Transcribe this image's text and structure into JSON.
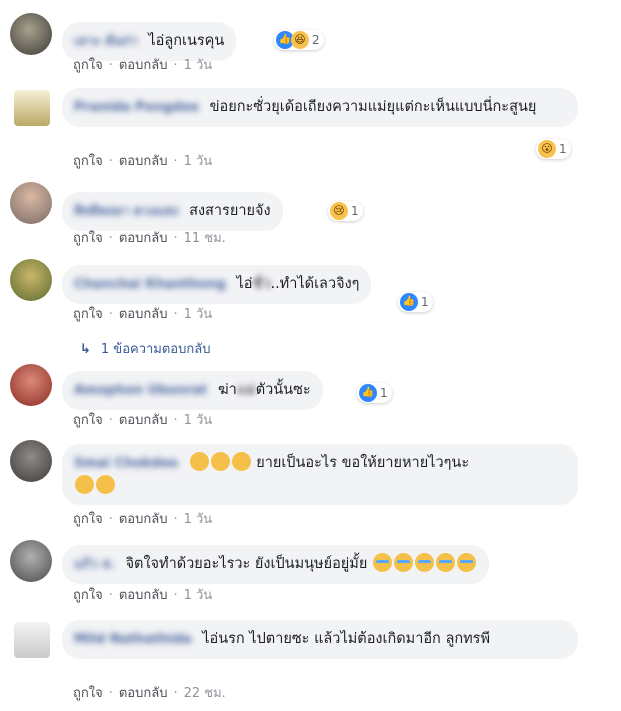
{
  "actions": {
    "like": "ถูกใจ",
    "reply": "ตอบกลับ",
    "sep": "·"
  },
  "comments": [
    {
      "author": "เลาะ ดันก่า",
      "text": "ไอ่ลูกเนรคุน",
      "time": "1 วัน",
      "reaction_count": "2",
      "reaction_icons": [
        "like-icon",
        "laugh-icon"
      ]
    },
    {
      "author": "Pranida Pongdee",
      "text": "ข่อยกะซั่วยุเด้อเถียงความแม่ยุแต่กะเห็นแบบนี่กะสูนยุ",
      "time": "1 วัน",
      "reaction_count": "1",
      "reaction_icons": [
        "wow-icon"
      ]
    },
    {
      "author": "สิทธิพงษา ดวงแสง",
      "text": "สงสารยายจัง",
      "time": "11 ชม.",
      "reaction_count": "1",
      "reaction_icons": [
        "sad-icon"
      ]
    },
    {
      "author": "Chanchai Khanthong",
      "text_before": "ไอ่",
      "text_blur": "ชั่ว",
      "text_after": "..ทำได้เลวจิงๆ",
      "time": "1 วัน",
      "reaction_count": "1",
      "reaction_icons": [
        "like-icon"
      ]
    },
    {
      "author": "Amophon Ubonrat",
      "text_before": "ฆ่า",
      "text_blur": "แม่",
      "text_after": "ตัวนั้นซะ",
      "time": "1 วัน",
      "reaction_count": "1",
      "reaction_icons": [
        "like-icon"
      ]
    },
    {
      "author": "Smai Chokdee",
      "text": "ยายเป็นอะไร ขอให้ยายหายไวๆนะ",
      "time": "1 วัน"
    },
    {
      "author": "แก้ว ส.",
      "text": "จิตใจทำด้วยอะไรวะ ยังเป็นมนุษย์อยู่มั้ย",
      "time": "1 วัน"
    },
    {
      "author": "Mild Nathathida",
      "text": "ไอ่นรก ไปตายซะ แล้วไม่ต้องเกิดมาอีก ลูกทรพี",
      "time": "22 ชม."
    }
  ],
  "replies_link": "1 ข้อความตอบกลับ",
  "colors": {
    "link": "#385898",
    "bubble": "#f2f3f5",
    "like": "#2d88ff"
  }
}
